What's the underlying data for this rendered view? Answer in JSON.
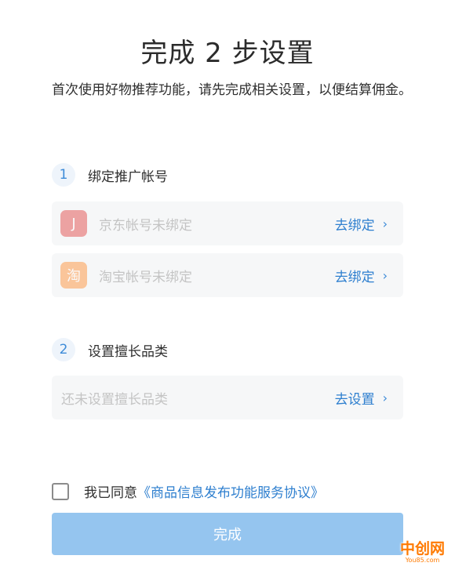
{
  "title": "完成 2 步设置",
  "description": "首次使用好物推荐功能，请先完成相关设置，以便结算佣金。",
  "step1": {
    "number": "1",
    "label": "绑定推广帐号",
    "rows": [
      {
        "icon": "jd-logo-icon",
        "icon_glyph": "J",
        "text": "京东帐号未绑定",
        "action": "去绑定"
      },
      {
        "icon": "taobao-logo-icon",
        "icon_glyph": "淘",
        "text": "淘宝帐号未绑定",
        "action": "去绑定"
      }
    ]
  },
  "step2": {
    "number": "2",
    "label": "设置擅长品类",
    "row": {
      "text": "还未设置擅长品类",
      "action": "去设置"
    }
  },
  "agreement": {
    "checked": false,
    "prefix": "我已同意",
    "link": "《商品信息发布功能服务协议》"
  },
  "done_button": "完成",
  "watermark": {
    "main": "中创网",
    "sub": "You85.com"
  },
  "colors": {
    "accent": "#2e7fcf",
    "button": "#95c5ef",
    "row_bg": "#f6f7f8",
    "jd": "#e23c3c",
    "taobao": "#ff8a2a"
  }
}
